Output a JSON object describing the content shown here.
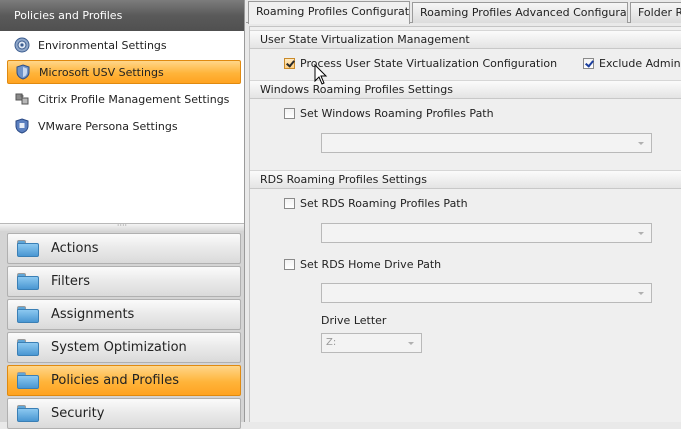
{
  "left": {
    "header": "Policies and Profiles",
    "sub_items": [
      {
        "label": "Environmental Settings",
        "icon": "gear-globe-icon"
      },
      {
        "label": "Microsoft USV Settings",
        "icon": "shield-icon",
        "selected": true
      },
      {
        "label": "Citrix Profile Management Settings",
        "icon": "puzzle-icon"
      },
      {
        "label": "VMware Persona Settings",
        "icon": "vmware-shield-icon"
      }
    ],
    "nav": [
      {
        "label": "Actions"
      },
      {
        "label": "Filters"
      },
      {
        "label": "Assignments"
      },
      {
        "label": "System Optimization"
      },
      {
        "label": "Policies and Profiles",
        "selected": true
      },
      {
        "label": "Security"
      }
    ]
  },
  "tabs": [
    {
      "label": "Roaming Profiles Configuration",
      "active": true
    },
    {
      "label": "Roaming Profiles Advanced Configuration"
    },
    {
      "label": "Folder Re"
    }
  ],
  "usv": {
    "header": "User State Virtualization Management",
    "process_label": "Process User State Virtualization Configuration",
    "process_checked": true,
    "exclude_label": "Exclude Administr",
    "exclude_checked": true
  },
  "windows": {
    "header": "Windows Roaming Profiles Settings",
    "set_path_label": "Set Windows Roaming Profiles Path",
    "set_path_checked": false,
    "path_value": ""
  },
  "rds": {
    "header": "RDS Roaming Profiles Settings",
    "set_path_label": "Set RDS Roaming Profiles Path",
    "set_path_checked": false,
    "path_value": "",
    "home_drive_label": "Set RDS Home Drive Path",
    "home_drive_checked": false,
    "home_path_value": "",
    "drive_letter_label": "Drive Letter",
    "drive_letter_value": "Z:"
  },
  "colors": {
    "selected_orange": "#ffb43a",
    "header_dark": "#5a5a5a",
    "checkbox_check": "#1c3f9e"
  }
}
